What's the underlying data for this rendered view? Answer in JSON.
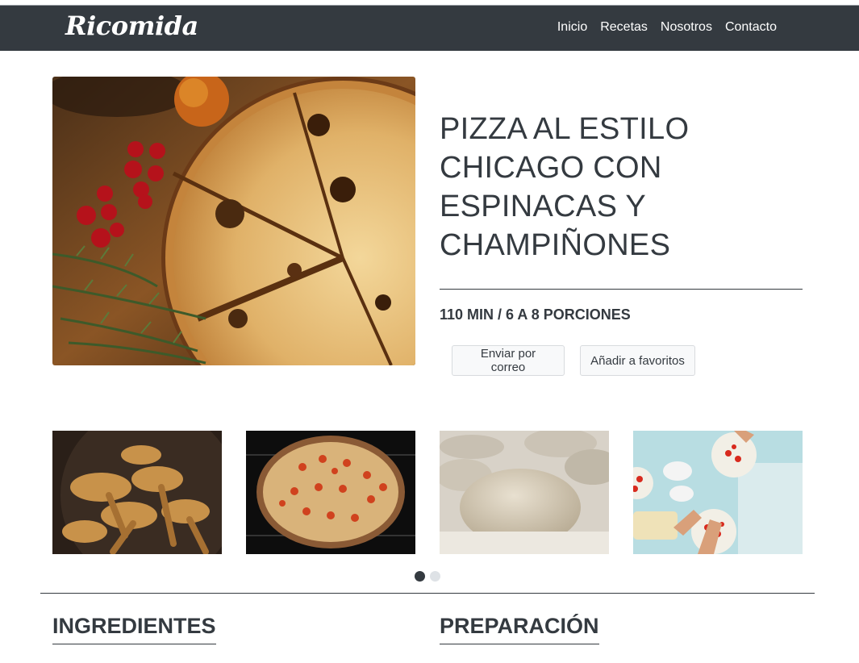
{
  "brand": {
    "name": "Ricomida"
  },
  "nav": {
    "items": [
      {
        "label": "Inicio"
      },
      {
        "label": "Recetas"
      },
      {
        "label": "Nosotros"
      },
      {
        "label": "Contacto"
      }
    ]
  },
  "recipe": {
    "title": "PIZZA AL ESTILO CHICAGO CON ESPINACAS Y CHAMPIÑONES",
    "meta": "110 MIN / 6 A 8 PORCIONES",
    "buttons": {
      "email": "Enviar por correo",
      "favorite": "Añadir a favoritos"
    }
  },
  "gallery": {
    "thumbnails": [
      {
        "icon": "mushrooms-photo"
      },
      {
        "icon": "pizza-photo"
      },
      {
        "icon": "dough-photo"
      },
      {
        "icon": "pizza-preparation-photo"
      }
    ],
    "pages": 2,
    "active_page": 1
  },
  "sections": {
    "ingredients": "INGREDIENTES",
    "preparation": "PREPARACIÓN"
  },
  "colors": {
    "navbar": "#343a40",
    "text": "#343a40",
    "button_bg": "#f8f9fa"
  }
}
